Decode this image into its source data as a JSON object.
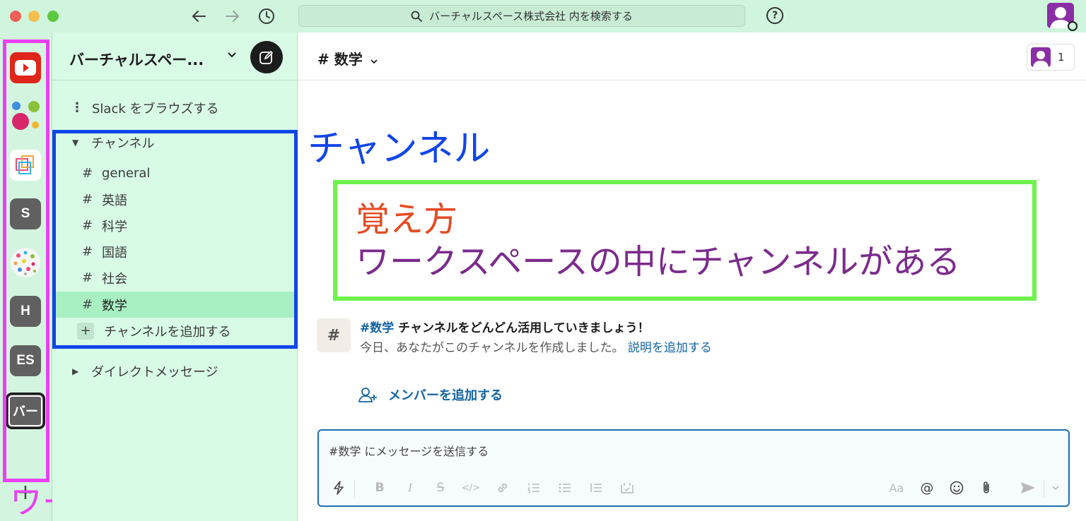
{
  "titlebar": {
    "search_placeholder": "バーチャルスペース株式会社 内を検索する",
    "help_label": "?"
  },
  "rail": {
    "workspaces": [
      {
        "name": "youtube",
        "label": ""
      },
      {
        "name": "dots",
        "label": ""
      },
      {
        "name": "squares",
        "label": ""
      },
      {
        "name": "s",
        "label": "S"
      },
      {
        "name": "confetti",
        "label": ""
      },
      {
        "name": "h",
        "label": "H"
      },
      {
        "name": "es",
        "label": "ES"
      },
      {
        "name": "ba",
        "label": "バー"
      }
    ],
    "add_label": "+",
    "caption": "ワークスペース"
  },
  "sidebar": {
    "workspace_name": "バーチャルスペー...",
    "browse_label": "Slack をブラウズする",
    "channels_section": "チャンネル",
    "channels": [
      "general",
      "英語",
      "科学",
      "国語",
      "社会",
      "数学"
    ],
    "active_channel": "数学",
    "add_channel_label": "チャンネルを追加する",
    "dm_section": "ダイレクトメッセージ"
  },
  "main": {
    "channel_title": "# 数学",
    "member_count": "1",
    "annotation_channel": "チャンネル",
    "annotation_line1": "覚え方",
    "annotation_line2": "ワークスペースの中にチャンネルがある",
    "intro_channel": "#数学",
    "intro_title_rest": " チャンネルをどんどん活用していきましょう！",
    "intro_sub": "今日、あなたがこのチャンネルを作成しました。 ",
    "intro_link": "説明を追加する",
    "add_member_label": "メンバーを追加する",
    "composer_placeholder": "#数学 にメッセージを送信する",
    "toolbar": {
      "bold": "B",
      "italic": "I",
      "strike": "S",
      "code": "</>",
      "format_text": "Aa",
      "mention": "@"
    }
  },
  "colors": {
    "sidebar_bg": "#d8fbe6",
    "active_channel_bg": "#a8f0c2",
    "workspace_outline": "#ea3ff2",
    "channel_outline": "#1045e8",
    "annotation_box": "#6ff24d",
    "annotation_red": "#e54a23",
    "annotation_purple": "#7b2b8c",
    "link": "#1264a3"
  }
}
